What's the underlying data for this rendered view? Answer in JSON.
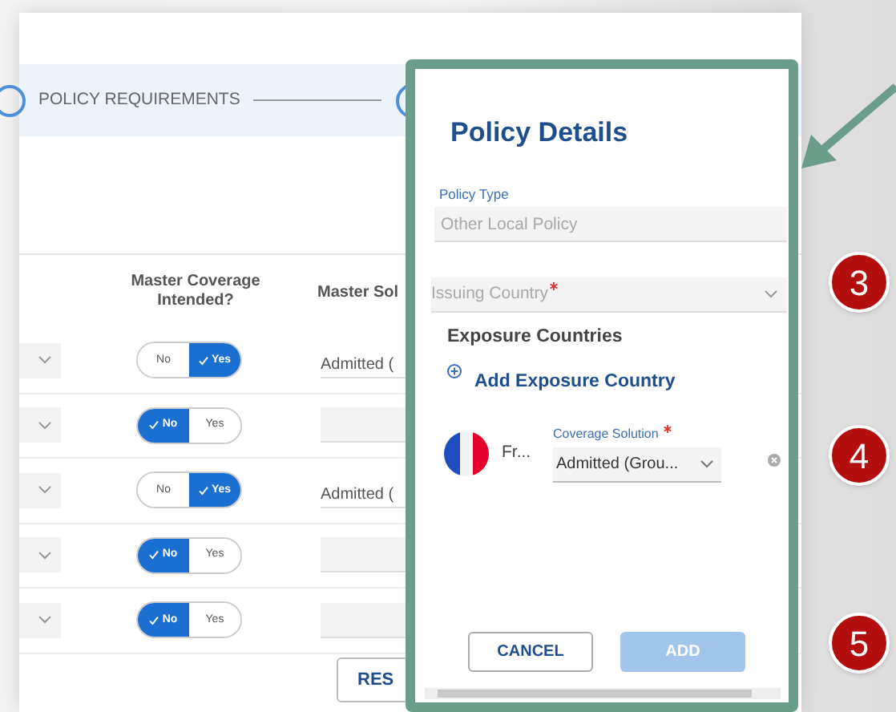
{
  "stepper": {
    "step_label": "POLICY REQUIREMENTS"
  },
  "table": {
    "columns": [
      {
        "label": "Master Coverage Intended?"
      },
      {
        "label": "Master Sol"
      }
    ],
    "rows": [
      {
        "master_coverage": [
          {
            "label": "No",
            "selected": false
          },
          {
            "label": "Yes",
            "selected": true
          }
        ],
        "master_solution": "Admitted ("
      },
      {
        "master_coverage": [
          {
            "label": "No",
            "selected": true
          },
          {
            "label": "Yes",
            "selected": false
          }
        ]
      },
      {
        "master_coverage": [
          {
            "label": "No",
            "selected": false
          },
          {
            "label": "Yes",
            "selected": true
          }
        ],
        "master_solution": "Admitted ("
      },
      {
        "master_coverage": [
          {
            "label": "No",
            "selected": true
          },
          {
            "label": "Yes",
            "selected": false
          }
        ]
      },
      {
        "master_coverage": [
          {
            "label": "No",
            "selected": true
          },
          {
            "label": "Yes",
            "selected": false
          }
        ]
      }
    ]
  },
  "reset_button": "RES",
  "dialog": {
    "title": "Policy Details",
    "policy_type": {
      "label": "Policy Type",
      "value": "Other Local Policy",
      "disabled": true
    },
    "issuing_country": {
      "placeholder": "Issuing Country",
      "required": true
    },
    "exposure_heading": "Exposure Countries",
    "add_link": "Add Exposure Country",
    "countries": [
      {
        "name": "Fr...",
        "coverage_label": "Coverage Solution",
        "required": true,
        "coverage_value": "Admitted (Grou..."
      }
    ],
    "buttons": [
      {
        "label": "CANCEL",
        "kind": "outline",
        "disabled": false
      },
      {
        "label": "ADD",
        "kind": "primary",
        "disabled": true
      }
    ]
  },
  "callouts": [
    "3",
    "4",
    "5"
  ]
}
